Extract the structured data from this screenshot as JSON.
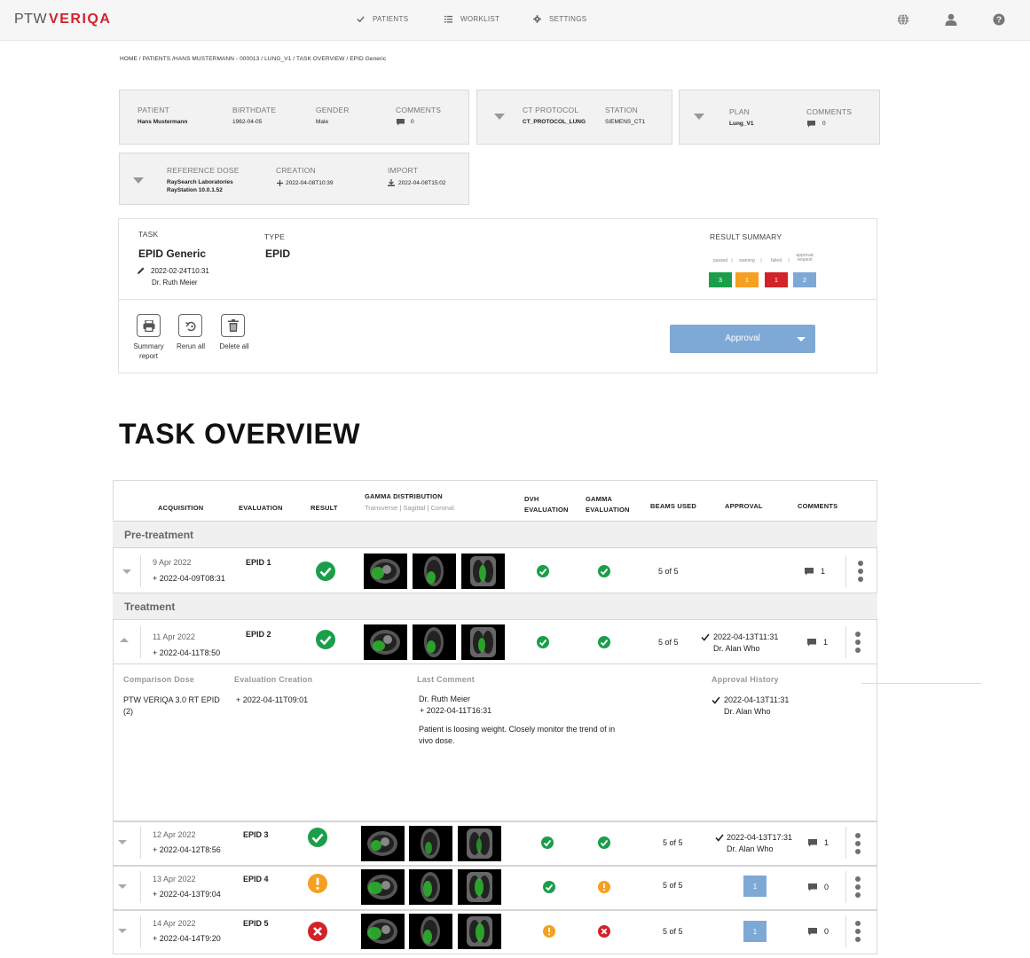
{
  "nav": {
    "logo_ptw": "PTW",
    "logo_veriqa": "VERIQA",
    "patients": "PATIENTS",
    "worklist": "WORKLIST",
    "settings": "SETTINGS"
  },
  "breadcrumb": "HOME / PATIENTS /HANS MUSTERMANN - 000013 / LUNG_V1 / TASK OVERVIEW / EPID Generic",
  "patient": {
    "patient_label": "PATIENT",
    "patient_value": "Hans Mustermann",
    "birthdate_label": "BIRTHDATE",
    "birthdate_value": "1962-04-05",
    "gender_label": "GENDER",
    "gender_value": "Male",
    "comments_label": "COMMENTS",
    "comments_value": "0"
  },
  "ct": {
    "protocol_label": "CT PROTOCOL",
    "protocol_value": "CT_PROTOCOL_LUNG",
    "station_label": "STATION",
    "station_value": "SIEMENS_CT1"
  },
  "plan": {
    "plan_label": "PLAN",
    "plan_value": "Lung_V1",
    "comments_label": "COMMENTS",
    "comments_value": "0"
  },
  "refdose": {
    "label": "REFERENCE DOSE",
    "value1": "RaySearch Laboratories",
    "value2": "RayStation 10.0.1.52",
    "creation_label": "CREATION",
    "creation_value": "2022-04-08T10:39",
    "import_label": "IMPORT",
    "import_value": "2022-04-08T15:02"
  },
  "task": {
    "task_label": "TASK",
    "task_name": "EPID Generic",
    "edited": "2022-02-24T10:31",
    "author": "Dr. Ruth Meier",
    "type_label": "TYPE",
    "type_value": "EPID",
    "summary_label": "RESULT SUMMARY",
    "summary": {
      "passed_label": "passed",
      "warning_label": "warning",
      "failed_label": "failed",
      "approval_label1": "approval",
      "approval_label2": "request",
      "passed": "3",
      "warning": "1",
      "failed": "1",
      "approval": "2"
    },
    "actions": {
      "summary1": "Summary",
      "summary2": "report",
      "rerun": "Rerun all",
      "delete": "Delete all"
    },
    "approval_button": "Approval"
  },
  "overview_title": "TASK OVERVIEW",
  "table": {
    "headers": {
      "acquisition": "ACQUISITION",
      "evaluation": "EVALUATION",
      "result": "RESULT",
      "gamma_dist": "GAMMA DISTRIBUTION",
      "gamma_dist_sub": "Transverse | Sagittal | Coronal",
      "dvh1": "DVH",
      "dvh2": "EVALUATION",
      "gamma1": "GAMMA",
      "gamma2": "EVALUATION",
      "beams": "BEAMS USED",
      "approval": "APPROVAL",
      "comments": "COMMENTS"
    },
    "sections": {
      "pre": "Pre-treatment",
      "treatment": "Treatment"
    },
    "rows": [
      {
        "date": "9 Apr 2022",
        "created": "2022-04-09T08:31",
        "evaluation": "EPID 1",
        "result": "passed",
        "dvh": "passed",
        "gamma": "passed",
        "beams": "5 of 5",
        "approval_date": "",
        "approval_by": "",
        "approval_pending": "",
        "comments": "1"
      },
      {
        "date": "11 Apr 2022",
        "created": "2022-04-11T8:50",
        "evaluation": "EPID 2",
        "result": "passed",
        "dvh": "passed",
        "gamma": "passed",
        "beams": "5 of 5",
        "approval_date": "2022-04-13T11:31",
        "approval_by": "Dr. Alan Who",
        "approval_pending": "",
        "comments": "1"
      },
      {
        "date": "12 Apr 2022",
        "created": "2022-04-12T8:56",
        "evaluation": "EPID 3",
        "result": "passed",
        "dvh": "passed",
        "gamma": "passed",
        "beams": "5 of 5",
        "approval_date": "2022-04-13T17:31",
        "approval_by": "Dr. Alan Who",
        "approval_pending": "",
        "comments": "1"
      },
      {
        "date": "13 Apr 2022",
        "created": "2022-04-13T9:04",
        "evaluation": "EPID 4",
        "result": "warning",
        "dvh": "passed",
        "gamma": "warning",
        "beams": "5 of 5",
        "approval_date": "",
        "approval_by": "",
        "approval_pending": "1",
        "comments": "0"
      },
      {
        "date": "14 Apr 2022",
        "created": "2022-04-14T9:20",
        "evaluation": "EPID 5",
        "result": "failed",
        "dvh": "warning",
        "gamma": "failed",
        "beams": "5 of 5",
        "approval_date": "",
        "approval_by": "",
        "approval_pending": "1",
        "comments": "0"
      }
    ],
    "detail": {
      "comparison_label": "Comparison Dose",
      "comparison_value": "PTW VERIQA 3.0 RT EPID (2)",
      "eval_creation_label": "Evaluation Creation",
      "eval_creation_value": "2022-04-11T09:01",
      "last_comment_label": "Last Comment",
      "last_comment_author": "Dr. Ruth Meier",
      "last_comment_date": "2022-04-11T16:31",
      "last_comment_text": "Patient is loosing weight. Closely monitor the trend of in vivo dose.",
      "history_label": "Approval History",
      "history_date": "2022-04-13T11:31",
      "history_by": "Dr. Alan Who"
    }
  },
  "colors": {
    "passed": "#1a9e4a",
    "warning": "#f5a020",
    "failed": "#d3222a",
    "approval": "#7ea8d6",
    "brand": "#d3222a"
  }
}
